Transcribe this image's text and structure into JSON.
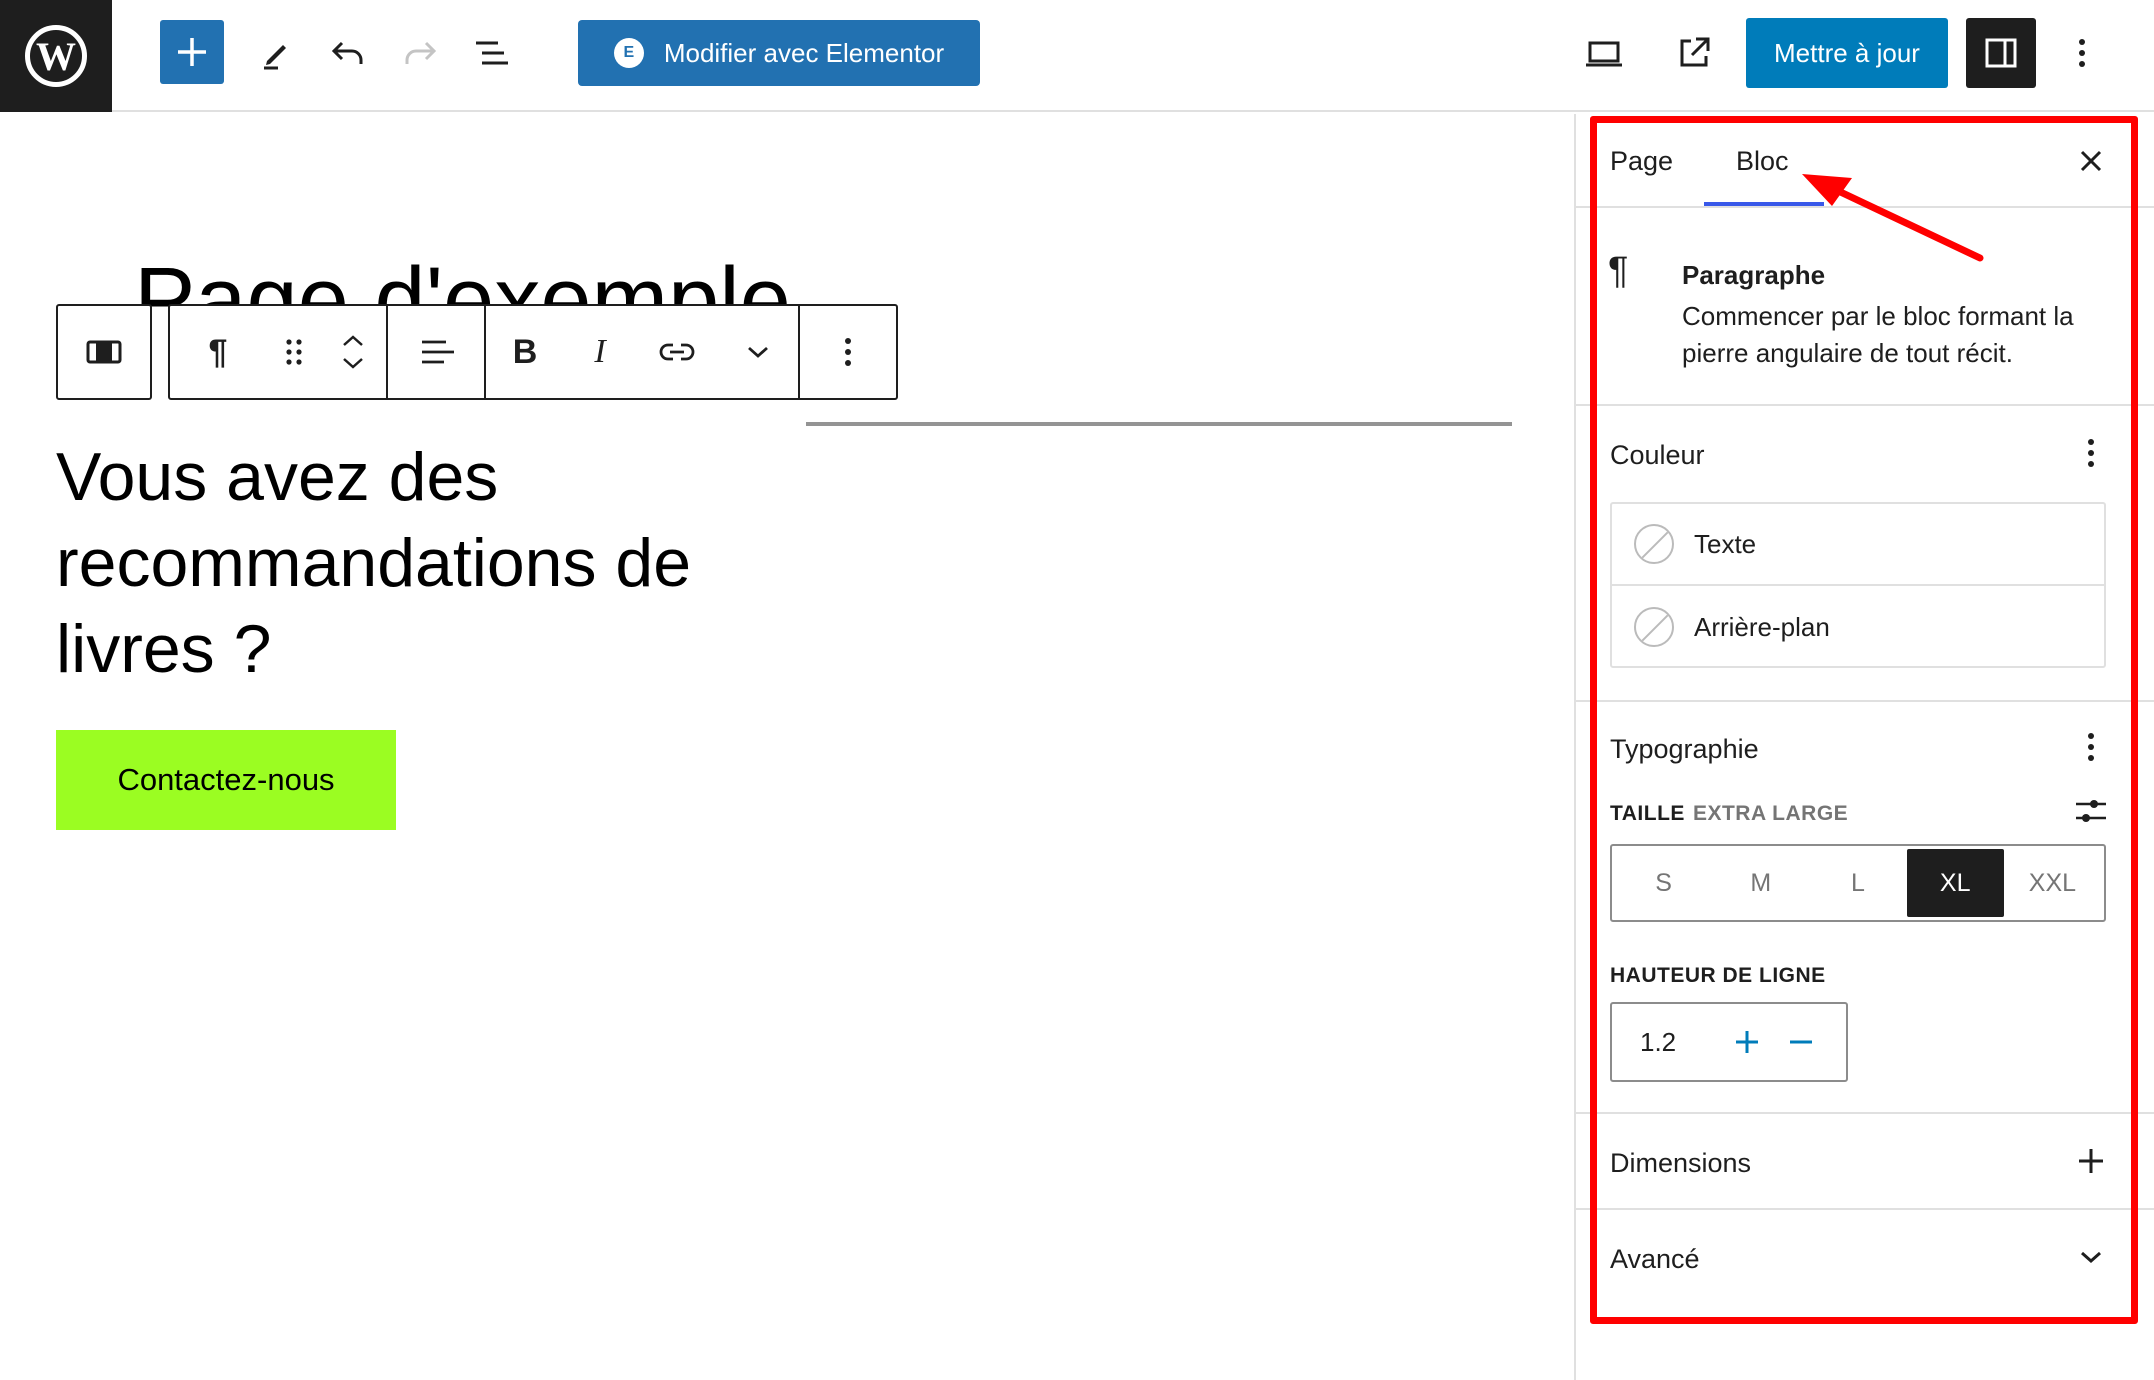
{
  "topbar": {
    "logo": "W",
    "add_icon": "plus-icon",
    "elementor_badge": "E",
    "elementor_label": "Modifier avec Elementor",
    "update_label": "Mettre à jour"
  },
  "canvas": {
    "page_title": "Page d'exemple",
    "heading": "Vous avez des recommandations de livres ?",
    "cta_label": "Contactez-nous",
    "cta_color": "#9bfd22",
    "toolbar": {
      "paragraph_icon": "¶",
      "bold": "B",
      "italic": "I"
    }
  },
  "sidebar": {
    "tabs": [
      {
        "label": "Page"
      },
      {
        "label": "Bloc",
        "active": true
      }
    ],
    "block": {
      "icon": "¶",
      "title": "Paragraphe",
      "description": "Commencer par le bloc formant la pierre angulaire de tout récit."
    },
    "color": {
      "title": "Couleur",
      "items": [
        "Texte",
        "Arrière-plan"
      ]
    },
    "typography": {
      "title": "Typographie",
      "size_label": "TAILLE",
      "size_value": "EXTRA LARGE",
      "sizes": [
        "S",
        "M",
        "L",
        "XL",
        "XXL"
      ],
      "selected_size": "XL",
      "line_height_label": "HAUTEUR DE LIGNE",
      "line_height_value": "1.2"
    },
    "dimensions": {
      "title": "Dimensions"
    },
    "advanced": {
      "title": "Avancé"
    }
  },
  "colors": {
    "accent": "#2271b1",
    "update_button": "#007cba",
    "highlight": "#ff0000"
  }
}
